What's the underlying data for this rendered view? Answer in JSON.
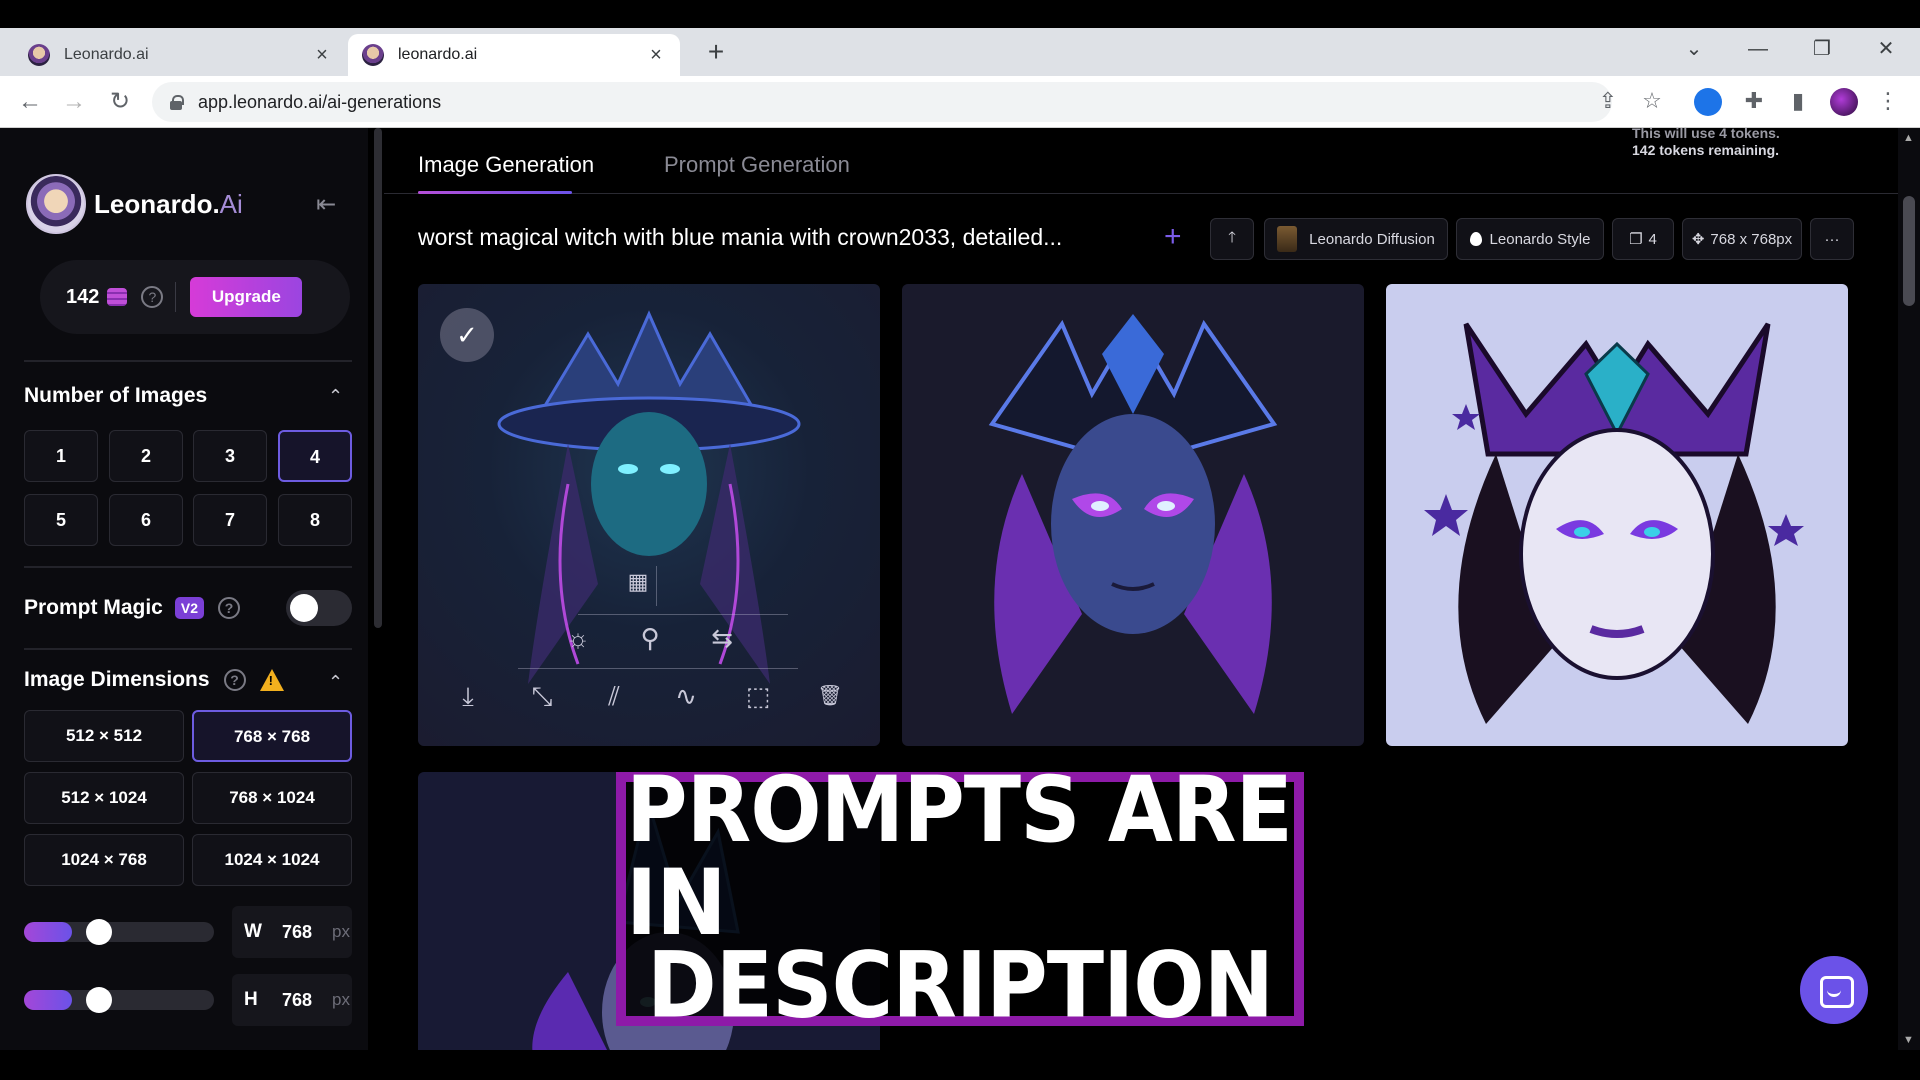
{
  "browser": {
    "tabs": [
      {
        "title": "Leonardo.ai",
        "close": "×"
      },
      {
        "title": "leonardo.ai",
        "close": "×"
      }
    ],
    "new_tab": "+",
    "url": "app.leonardo.ai/ai-generations",
    "nav": {
      "back": "←",
      "forward": "→",
      "reload": "↻"
    },
    "window": {
      "dropdown": "⌄",
      "minimize": "—",
      "restore": "❐",
      "close": "✕"
    },
    "omni_icons": {
      "share": "⇪",
      "star": "☆",
      "extensions": "✚",
      "sidepanel": "▮",
      "menu": "⋮"
    }
  },
  "sidebar": {
    "brand": "Leonardo.",
    "brand_suffix": "Ai",
    "collapse_icon": "⇤",
    "tokens": "142",
    "help": "?",
    "upgrade": "Upgrade",
    "number_of_images": {
      "title": "Number of Images",
      "chevron": "⌃",
      "options": [
        "1",
        "2",
        "3",
        "4",
        "5",
        "6",
        "7",
        "8"
      ],
      "selected": "4"
    },
    "prompt_magic": {
      "title": "Prompt Magic",
      "badge": "V2",
      "help": "?",
      "enabled": false
    },
    "image_dimensions": {
      "title": "Image Dimensions",
      "help": "?",
      "warning": "!",
      "chevron": "⌃",
      "options": [
        "512 × 512",
        "768 × 768",
        "512 × 1024",
        "768 × 1024",
        "1024 × 768",
        "1024 × 1024"
      ],
      "selected": "768 × 768",
      "width": {
        "label": "W",
        "value": "768",
        "unit": "px",
        "slider_fraction": 0.2
      },
      "height": {
        "label": "H",
        "value": "768",
        "unit": "px",
        "slider_fraction": 0.2
      }
    }
  },
  "main": {
    "tabs": [
      "Image Generation",
      "Prompt Generation"
    ],
    "active_tab": "Image Generation",
    "token_note": {
      "line1": "This will use 4 tokens.",
      "line2": "142 tokens remaining."
    },
    "prompt": "worst magical witch with blue mania with crown2033, detailed...",
    "add_icon": "+",
    "controls": {
      "upload_icon": "🡑",
      "model": "Leonardo Diffusion",
      "style": "Leonardo Style",
      "count_icon": "❐",
      "count": "4",
      "move_icon": "✥",
      "size": "768 x 768px",
      "more": "···"
    },
    "overlay": {
      "line1": "PROMPTS ARE IN",
      "line2": "DESCRIPTION"
    },
    "image_tools": {
      "check": "✓",
      "qr": "▦",
      "sun": "☼",
      "tree": "⚲",
      "swap": "⇆",
      "download": "⤓",
      "expand": "⤡",
      "slash": "⫽",
      "curve": "∿",
      "crop": "⬚",
      "trash": "🗑"
    }
  },
  "colors": {
    "accent": "#6b52e8",
    "accent_pink": "#d63bd8",
    "banner_border": "#8e1aa8"
  }
}
